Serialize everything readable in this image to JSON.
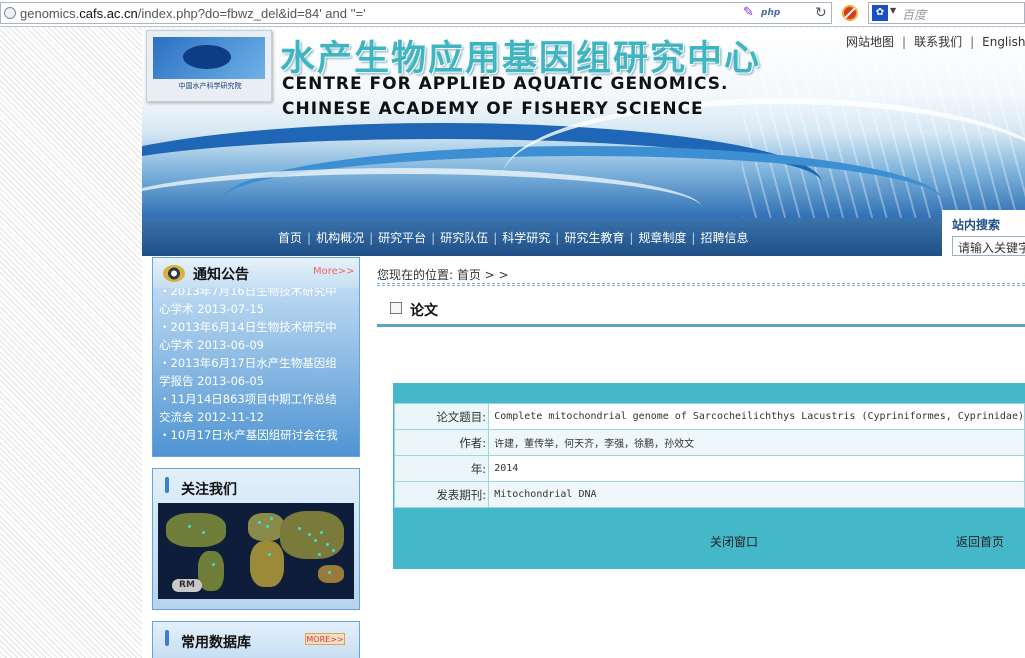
{
  "browser": {
    "url_host_prefix": "genomics.",
    "url_domain": "cafs.ac.cn",
    "url_path": "/index.php?do=fbwz_del&id=84'  and ''='",
    "php_badge": "php",
    "search_placeholder": "百度"
  },
  "header": {
    "logo_text": "中国水产科学研究院",
    "title_cn": "水产生物应用基因组研究中心",
    "title_en_line1": "CENTRE FOR APPLIED AQUATIC GENOMICS.",
    "title_en_line2": "CHINESE ACADEMY OF FISHERY SCIENCE",
    "top_links": [
      "网站地图",
      "联系我们",
      "English"
    ]
  },
  "nav": {
    "items": [
      "首页",
      "机构概况",
      "研究平台",
      "研究队伍",
      "科学研究",
      "研究生教育",
      "规章制度",
      "招聘信息"
    ]
  },
  "site_search": {
    "title": "站内搜索",
    "placeholder": "请输入关键字"
  },
  "notice": {
    "title": "通知公告",
    "more": "More>>",
    "items": [
      "・2013年7月16日生物技术研究中心学术 2013-07-15",
      "・2013年6月14日生物技术研究中心学术 2013-06-09",
      "・2013年6月17日水产生物基因组学报告 2013-06-05",
      "・11月14日863项目中期工作总结交流会 2012-11-12",
      "・10月17日水产基因组研讨会在我"
    ]
  },
  "follow": {
    "title": "关注我们",
    "badge": "RM"
  },
  "database": {
    "title": "常用数据库",
    "more": "MORE>>"
  },
  "content": {
    "breadcrumb": "您现在的位置: 首页 >  >",
    "section_title": "论文",
    "rows": [
      {
        "label": "论文题目:",
        "value": "Complete mitochondrial genome of Sarcocheilichthys Lacustris (Cypriniformes, Cyprinidae)"
      },
      {
        "label": "作者:",
        "value": "许建，董传举，何天齐，李强，徐鹏，孙效文"
      },
      {
        "label": "年:",
        "value": "2014"
      },
      {
        "label": "发表期刊:",
        "value": "Mitochondrial DNA"
      }
    ],
    "close_label": "关闭窗口",
    "home_label": "返回首页"
  }
}
